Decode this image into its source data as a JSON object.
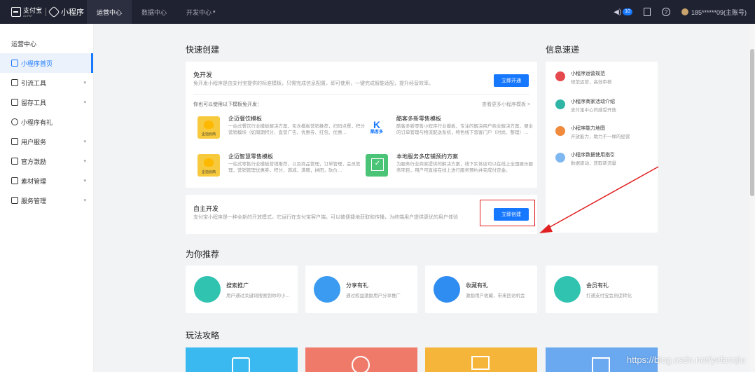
{
  "topbar": {
    "logo_text": "支付宝",
    "logo_sub": "ALIPAY",
    "product": "小程序",
    "tabs": [
      {
        "label": "运营中心",
        "active": true
      },
      {
        "label": "数据中心",
        "active": false
      },
      {
        "label": "开发中心",
        "active": false
      }
    ],
    "dev_caret": "▾",
    "notice_count": "10",
    "user": "185******09(主账号)"
  },
  "sidebar": {
    "header": "运营中心",
    "items": [
      {
        "label": "小程序首页",
        "active": true,
        "has_children": false
      },
      {
        "label": "引流工具",
        "active": false,
        "has_children": true
      },
      {
        "label": "留存工具",
        "active": false,
        "has_children": true
      },
      {
        "label": "小程序有礼",
        "active": false,
        "has_children": false
      },
      {
        "label": "用户服务",
        "active": false,
        "has_children": true
      },
      {
        "label": "官方激励",
        "active": false,
        "has_children": true
      },
      {
        "label": "素材管理",
        "active": false,
        "has_children": true
      },
      {
        "label": "服务管理",
        "active": false,
        "has_children": true
      }
    ]
  },
  "quick": {
    "title": "快速创建",
    "free_title": "免开发",
    "free_desc": "免开发小程序是由支付宝提供的标准模板，只需完成信息配置，即可使用，一键完成智能适配，提升经营效率。",
    "free_btn": "立即开通",
    "tpl_hint": "你也可以使用以下模板免开发：",
    "tpl_more": "查看更多小程序模板 >",
    "templates": [
      {
        "title": "企迈餐饮模板",
        "desc": "一站式餐饮行业模板解决方案，包含模板营销推荐，扫码点餐，积分营销模块（如周期积分、直营广告、优惠劵、红包、优惠…",
        "logo": "企迈云商"
      },
      {
        "title": "酷客多新零售模板",
        "desc": "酷客多新零售小程序行业模板，专注的解决用户商业解决方案，便全的订单管理与物流配送系统，特色线下营客门户（时尚、整理）…",
        "logo": "酷客多"
      },
      {
        "title": "企迈智慧零售模板",
        "desc": "一站式零售行业模板营销推荐，以及商品管理，订单管理，会员管理，营销管理优惠券，积分，满减，满赠，拼团，砍价…",
        "logo": "企迈云商"
      },
      {
        "title": "本地服务多店铺预约方案",
        "desc": "为服务行业商家提供的解决方案，线下实体店可以在线上全国展示服务项目，用户可直接在线上进行服务预约并完成付定金。",
        "logo": ""
      }
    ],
    "self_title": "自主开发",
    "self_desc": "支付宝小程序是一种全新的开放模式，它运行在支付宝客户端，可以被便捷地获取和传播，为终端用户提供更优的用户体验",
    "self_btn": "立即创建"
  },
  "info": {
    "title": "信息速递",
    "items": [
      {
        "title": "小程序运营规范",
        "desc": "规范运营，高效审核"
      },
      {
        "title": "小程序商家活动介绍",
        "desc": "支付宝中心的感受开放"
      },
      {
        "title": "小程序能力地图",
        "desc": "开放能力，助力不一样的经营"
      },
      {
        "title": "小程序数据使用指引",
        "desc": "数据驱动，获取新流量"
      }
    ]
  },
  "recommend": {
    "title": "为你推荐",
    "items": [
      {
        "title": "搜索推广",
        "desc": "用户通过关键词搜索到你的小…"
      },
      {
        "title": "分享有礼",
        "desc": "通过权益激励用户分享推广"
      },
      {
        "title": "收藏有礼",
        "desc": "激励用户收藏，带来回访机会"
      },
      {
        "title": "会员有礼",
        "desc": "打通支付宝会员促转化"
      }
    ]
  },
  "strategy": {
    "title": "玩法攻略"
  },
  "watermark": "https://blog.csdn.net/yefanqiu",
  "colors": {
    "primary": "#1677ff",
    "nav_bg": "#1f2230",
    "highlight": "#e02020"
  }
}
